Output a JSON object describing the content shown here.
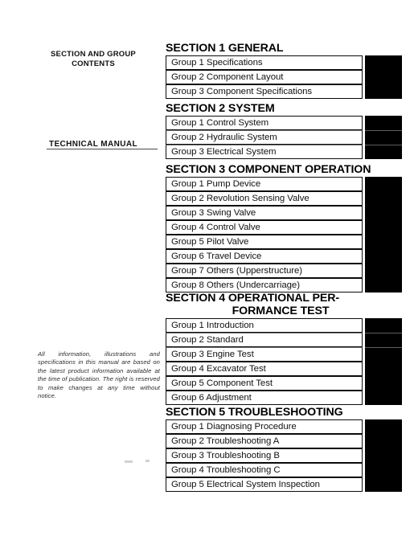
{
  "page": {
    "left_heading": "SECTION AND GROUP\nCONTENTS",
    "left_heading_line1": "SECTION AND GROUP",
    "left_heading_line2": "CONTENTS",
    "manual_title": "TECHNICAL MANUAL",
    "disclaimer": "All information, illustrations and specifications in this manual are based on the latest product information available at the time of publication. The right is reserved to make changes at any time without notice."
  },
  "colors": {
    "text": "#000000",
    "tab": "#000000",
    "rule": "#4a4a4a",
    "background": "#ffffff"
  },
  "contents": {
    "sections": [
      {
        "heading": "SECTION 1 GENERAL",
        "heading_line2": "",
        "groups": [
          {
            "label": "Group 1 Specifications"
          },
          {
            "label": "Group 2 Component Layout"
          },
          {
            "label": "Group 3 Component Specifications"
          }
        ]
      },
      {
        "heading": "SECTION 2 SYSTEM",
        "heading_line2": "",
        "groups": [
          {
            "label": "Group 1 Control System"
          },
          {
            "label": "Group 2 Hydraulic System"
          },
          {
            "label": "Group 3 Electrical System"
          }
        ]
      },
      {
        "heading": "SECTION 3 COMPONENT OPERATION",
        "heading_line2": "",
        "groups": [
          {
            "label": "Group 1 Pump Device"
          },
          {
            "label": "Group 2 Revolution Sensing Valve"
          },
          {
            "label": "Group 3 Swing Valve"
          },
          {
            "label": "Group 4 Control Valve"
          },
          {
            "label": "Group 5 Pilot Valve"
          },
          {
            "label": "Group 6 Travel Device"
          },
          {
            "label": "Group 7 Others (Upperstructure)"
          },
          {
            "label": "Group 8 Others (Undercarriage)"
          }
        ]
      },
      {
        "heading": "SECTION 4  OPERATIONAL PER-",
        "heading_line2": "FORMANCE TEST",
        "groups": [
          {
            "label": "Group 1 Introduction"
          },
          {
            "label": "Group 2 Standard"
          },
          {
            "label": "Group 3 Engine Test"
          },
          {
            "label": "Group 4 Excavator Test"
          },
          {
            "label": "Group 5 Component Test"
          },
          {
            "label": "Group 6 Adjustment"
          }
        ]
      },
      {
        "heading": "SECTION 5 TROUBLESHOOTING",
        "heading_line2": "",
        "groups": [
          {
            "label": "Group 1 Diagnosing Procedure"
          },
          {
            "label": "Group 2 Troubleshooting A"
          },
          {
            "label": "Group 3 Troubleshooting B"
          },
          {
            "label": "Group 4 Troubleshooting C"
          },
          {
            "label": "Group 5 Electrical System Inspection"
          }
        ]
      }
    ]
  }
}
